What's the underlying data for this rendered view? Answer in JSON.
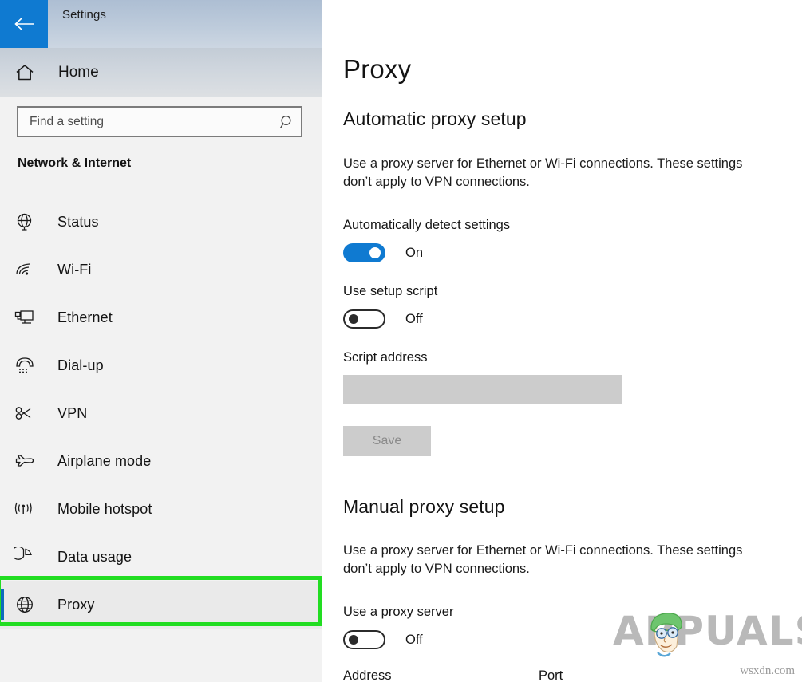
{
  "window": {
    "title": "Settings",
    "back_icon": "back-arrow-icon"
  },
  "sidebar": {
    "home": {
      "label": "Home",
      "icon": "home-icon"
    },
    "search": {
      "placeholder": "Find a setting",
      "value": "",
      "icon": "search-icon"
    },
    "category": "Network & Internet",
    "items": [
      {
        "label": "Status",
        "icon": "globe-icon",
        "selected": false
      },
      {
        "label": "Wi-Fi",
        "icon": "wifi-icon",
        "selected": false
      },
      {
        "label": "Ethernet",
        "icon": "ethernet-icon",
        "selected": false
      },
      {
        "label": "Dial-up",
        "icon": "dialup-icon",
        "selected": false
      },
      {
        "label": "VPN",
        "icon": "vpn-key-icon",
        "selected": false
      },
      {
        "label": "Airplane mode",
        "icon": "airplane-icon",
        "selected": false
      },
      {
        "label": "Mobile hotspot",
        "icon": "mobile-hotspot-icon",
        "selected": false
      },
      {
        "label": "Data usage",
        "icon": "pie-chart-icon",
        "selected": false
      },
      {
        "label": "Proxy",
        "icon": "globe-icon",
        "selected": true
      }
    ]
  },
  "main": {
    "page_title": "Proxy",
    "automatic": {
      "heading": "Automatic proxy setup",
      "description": "Use a proxy server for Ethernet or Wi-Fi connections. These settings don’t apply to VPN connections.",
      "auto_detect_label": "Automatically detect settings",
      "auto_detect_state": "On",
      "setup_script_label": "Use setup script",
      "setup_script_state": "Off",
      "script_address_label": "Script address",
      "script_address_value": "",
      "save_label": "Save"
    },
    "manual": {
      "heading": "Manual proxy setup",
      "description": "Use a proxy server for Ethernet or Wi-Fi connections. These settings don’t apply to VPN connections.",
      "use_proxy_label": "Use a proxy server",
      "use_proxy_state": "Off",
      "address_label": "Address",
      "port_label": "Port"
    }
  },
  "watermark": {
    "brand": "APPUALS",
    "site": "wsxdn.com"
  },
  "colors": {
    "accent_blue": "#0f7ad1",
    "selected_bar": "#0f6cbd",
    "highlight_green": "#22dd22",
    "sidebar_bg": "#f2f2f2",
    "disabled_gray": "#cccccc"
  }
}
